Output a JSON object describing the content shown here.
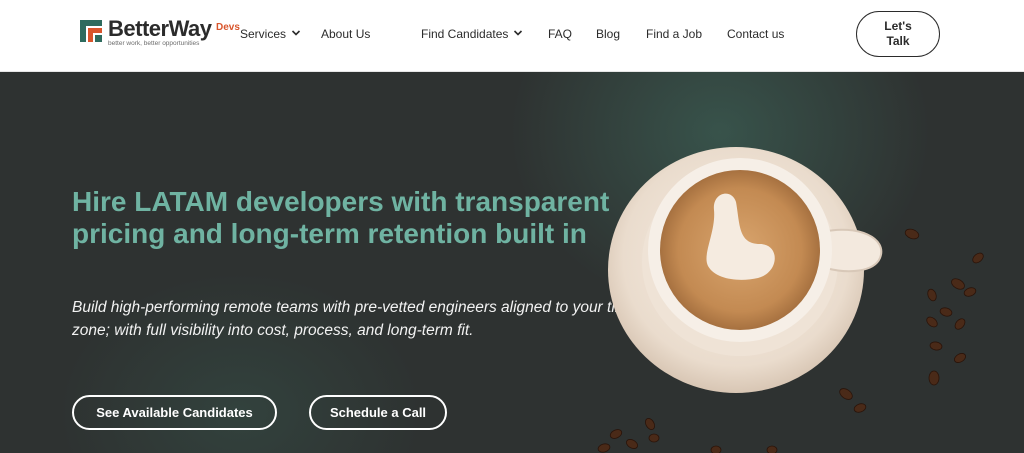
{
  "brand": {
    "name": "BetterWay",
    "suffix": "Devs",
    "tagline": "better work, better opportunities",
    "colors": {
      "green": "#2e6b5e",
      "orange": "#d9552c"
    }
  },
  "nav": {
    "services": "Services",
    "about": "About Us",
    "find_candidates": "Find Candidates",
    "faq": "FAQ",
    "blog": "Blog",
    "find_job": "Find a Job",
    "contact": "Contact us"
  },
  "cta": {
    "talk": "Let's\nTalk"
  },
  "hero": {
    "title": "Hire LATAM developers with transparent pricing and long-term retention built in",
    "subtitle": "Build high-performing remote teams with pre-vetted engineers aligned to your time zone; with full visibility into cost, process, and long-term fit.",
    "btn_candidates": "See Available Candidates",
    "btn_call": "Schedule a Call",
    "title_color": "#6fb3a2",
    "bg_color": "#2e3231"
  },
  "icons": {
    "dropdown": "chevron-down-icon",
    "illustration": "coffee-cup-illustration"
  }
}
